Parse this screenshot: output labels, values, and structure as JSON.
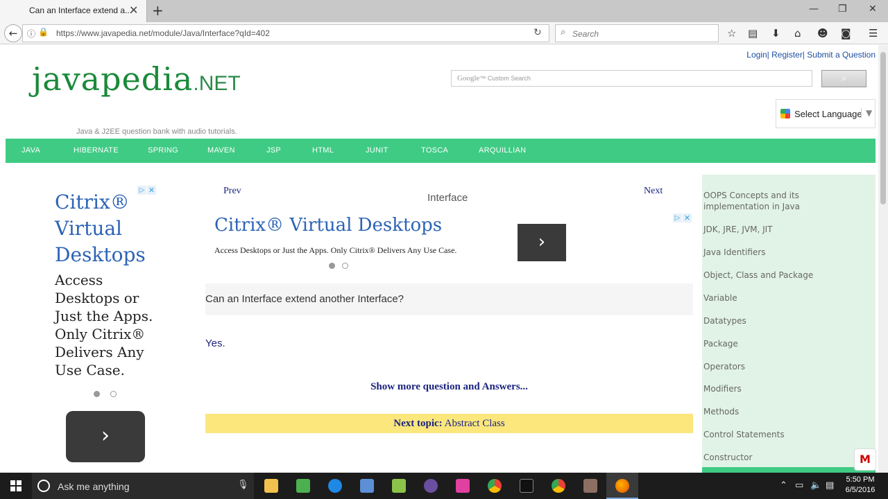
{
  "browser": {
    "tab_title": "Can an Interface extend a...",
    "url": "https://www.javapedia.net/module/Java/Interface?qId=402",
    "search_placeholder": "Search"
  },
  "site": {
    "top_links": [
      "Login|",
      "Register|",
      "Submit a Question"
    ],
    "logo_word": "javapedia",
    "logo_suffix": ".NET",
    "tagline": "Java & J2EE question bank with audio tutorials.",
    "google_search_placeholder": "Google",
    "google_search_placeholder_small": "™ Custom Search",
    "language_label": "Select Language",
    "menu": [
      "JAVA",
      "HIBERNATE",
      "SPRING",
      "MAVEN",
      "JSP",
      "HTML",
      "JUNIT",
      "TOSCA",
      "ARQUILLIAN"
    ]
  },
  "left_ad": {
    "headline": "Citrix® Virtual Desktops",
    "body": "Access Desktops or Just the Apps. Only Citrix® Delivers Any Use Case."
  },
  "main": {
    "prev_label": "Prev",
    "next_label": "Next",
    "title": "Interface",
    "ad_headline": "Citrix® Virtual Desktops",
    "ad_body": "Access Desktops or Just the Apps. Only Citrix® Delivers Any Use Case.",
    "question": "Can an Interface extend another Interface?",
    "answer": "Yes.",
    "show_more": "Show more question and Answers...",
    "next_topic_label": "Next topic:",
    "next_topic_link": "Abstract Class"
  },
  "sidebar": {
    "items": [
      "OOPS Concepts and its implementation in Java",
      "JDK, JRE, JVM, JIT",
      "Java Identifiers",
      "Object, Class and Package",
      "Variable",
      "Datatypes",
      "Package",
      "Operators",
      "Modifiers",
      "Methods",
      "Control Statements",
      "Constructor"
    ]
  },
  "taskbar": {
    "search_placeholder": "Ask me anything",
    "time": "5:50 PM",
    "date": "6/5/2016"
  },
  "colors": {
    "menu_green": "#3fcb84",
    "sidebar_bg": "#e1f3e6",
    "link_blue": "#1a237e",
    "next_topic_bg": "#fce77d"
  }
}
